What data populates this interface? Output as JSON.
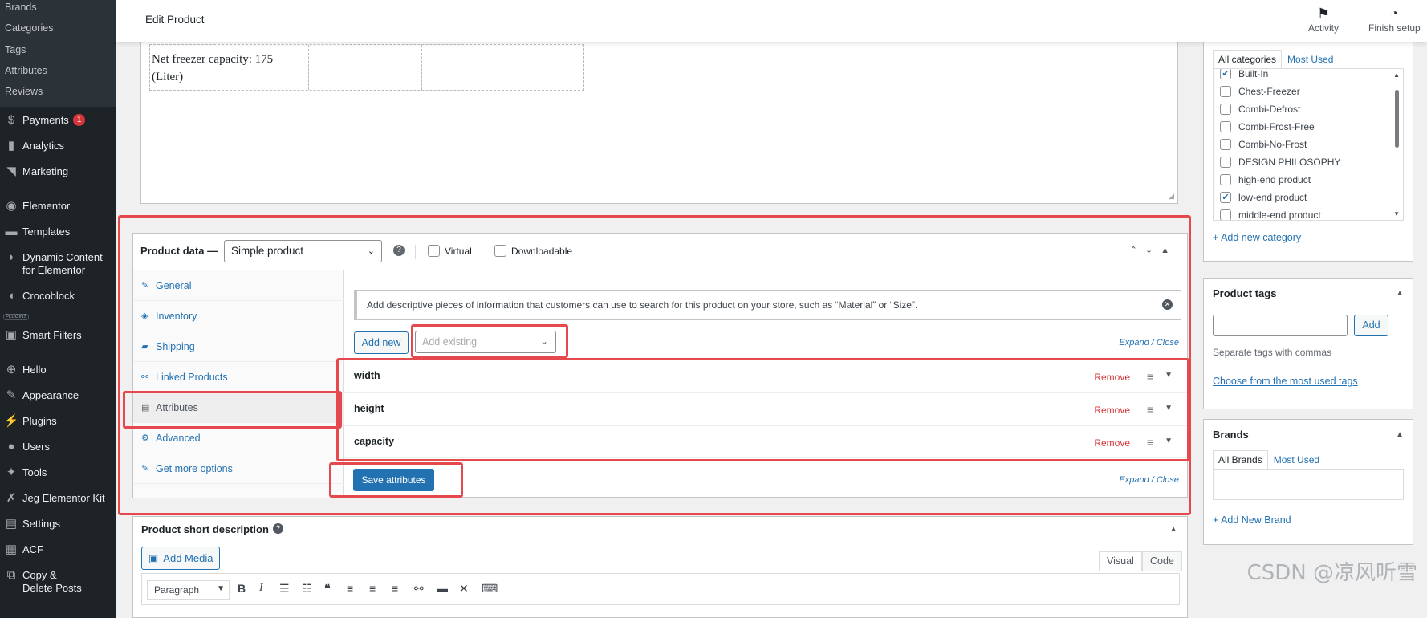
{
  "sidebar": {
    "sub_items": [
      "Brands",
      "Categories",
      "Tags",
      "Attributes",
      "Reviews"
    ],
    "items": [
      {
        "label": "Payments",
        "icon": "payments-icon",
        "glyph": "$",
        "badge": "1"
      },
      {
        "label": "Analytics",
        "icon": "analytics-icon",
        "glyph": "▮"
      },
      {
        "label": "Marketing",
        "icon": "marketing-icon",
        "glyph": "◥"
      },
      {
        "label": "Elementor",
        "icon": "elementor-icon",
        "glyph": "◉"
      },
      {
        "label": "Templates",
        "icon": "folder-icon",
        "glyph": "▬"
      },
      {
        "label": "Dynamic Content",
        "label2": "for Elementor",
        "icon": "dynamic-content-icon",
        "glyph": "◗"
      },
      {
        "label": "Crocoblock",
        "icon": "crocoblock-icon",
        "glyph": "◖"
      },
      {
        "label": "Smart Filters",
        "icon": "jet-icon",
        "glyph": "▣"
      },
      {
        "label": "Hello",
        "icon": "plus-circle-icon",
        "glyph": "⊕"
      },
      {
        "label": "Appearance",
        "icon": "brush-icon",
        "glyph": "✎"
      },
      {
        "label": "Plugins",
        "icon": "plugin-icon",
        "glyph": "⚡"
      },
      {
        "label": "Users",
        "icon": "user-icon",
        "glyph": "●"
      },
      {
        "label": "Tools",
        "icon": "wrench-icon",
        "glyph": "✦"
      },
      {
        "label": "Jeg Elementor Kit",
        "icon": "jeg-icon",
        "glyph": "✗"
      },
      {
        "label": "Settings",
        "icon": "settings-icon",
        "glyph": "▤"
      },
      {
        "label": "ACF",
        "icon": "acf-icon",
        "glyph": "▦"
      },
      {
        "label": "Copy &",
        "label2": "Delete Posts",
        "icon": "copy-icon",
        "glyph": "⧉"
      }
    ],
    "plugins_tag": "PLUGINS"
  },
  "topbar": {
    "title": "Edit Product",
    "activity": "Activity",
    "finish_setup": "Finish setup"
  },
  "editor": {
    "table_text_line1": "Net freezer capacity: 175",
    "table_text_line2": "(Liter)"
  },
  "product_data": {
    "title": "Product data —",
    "type_select": "Simple product",
    "virtual_label": "Virtual",
    "downloadable_label": "Downloadable",
    "tabs": [
      {
        "label": "General",
        "icon": "wrench-icon",
        "glyph": "🔧"
      },
      {
        "label": "Inventory",
        "icon": "tag-icon",
        "glyph": "◈"
      },
      {
        "label": "Shipping",
        "icon": "truck-icon",
        "glyph": "▰"
      },
      {
        "label": "Linked Products",
        "icon": "link-icon",
        "glyph": "🔗"
      },
      {
        "label": "Attributes",
        "icon": "list-icon",
        "glyph": "▤"
      },
      {
        "label": "Advanced",
        "icon": "gear-icon",
        "glyph": "⚙"
      },
      {
        "label": "Get more options",
        "icon": "plugin-icon",
        "glyph": "✎"
      }
    ],
    "active_tab": "Attributes",
    "notice": "Add descriptive pieces of information that customers can use to search for this product on your store, such as “Material” or “Size”.",
    "add_new_label": "Add new",
    "add_existing_placeholder": "Add existing",
    "expand_close": "Expand / Close",
    "attributes": [
      {
        "name": "width",
        "remove": "Remove"
      },
      {
        "name": "height",
        "remove": "Remove"
      },
      {
        "name": "capacity",
        "remove": "Remove"
      }
    ],
    "save_label": "Save attributes"
  },
  "short_description": {
    "title": "Product short description",
    "add_media": "Add Media",
    "visual_tab": "Visual",
    "code_tab": "Code",
    "paragraph": "Paragraph"
  },
  "categories": {
    "tab_all": "All categories",
    "tab_most": "Most Used",
    "items": [
      {
        "label": "Built-In",
        "checked": true
      },
      {
        "label": "Chest-Freezer",
        "checked": false
      },
      {
        "label": "Combi-Defrost",
        "checked": false
      },
      {
        "label": "Combi-Frost-Free",
        "checked": false
      },
      {
        "label": "Combi-No-Frost",
        "checked": false
      },
      {
        "label": "DESIGN PHILOSOPHY",
        "checked": false
      },
      {
        "label": "high-end product",
        "checked": false
      },
      {
        "label": "low-end product",
        "checked": true
      },
      {
        "label": "middle-end product",
        "checked": false
      }
    ],
    "add_new": "+ Add new category"
  },
  "product_tags": {
    "title": "Product tags",
    "add_label": "Add",
    "note": "Separate tags with commas",
    "choose_link": "Choose from the most used tags"
  },
  "brands": {
    "title": "Brands",
    "tab_all": "All Brands",
    "tab_most": "Most Used",
    "add_new": "+ Add New Brand"
  },
  "watermark": "CSDN @凉风听雪",
  "colors": {
    "accent": "#2271b1",
    "highlight": "#e5484d",
    "danger": "#d63638",
    "sidebar": "#1d2327"
  }
}
